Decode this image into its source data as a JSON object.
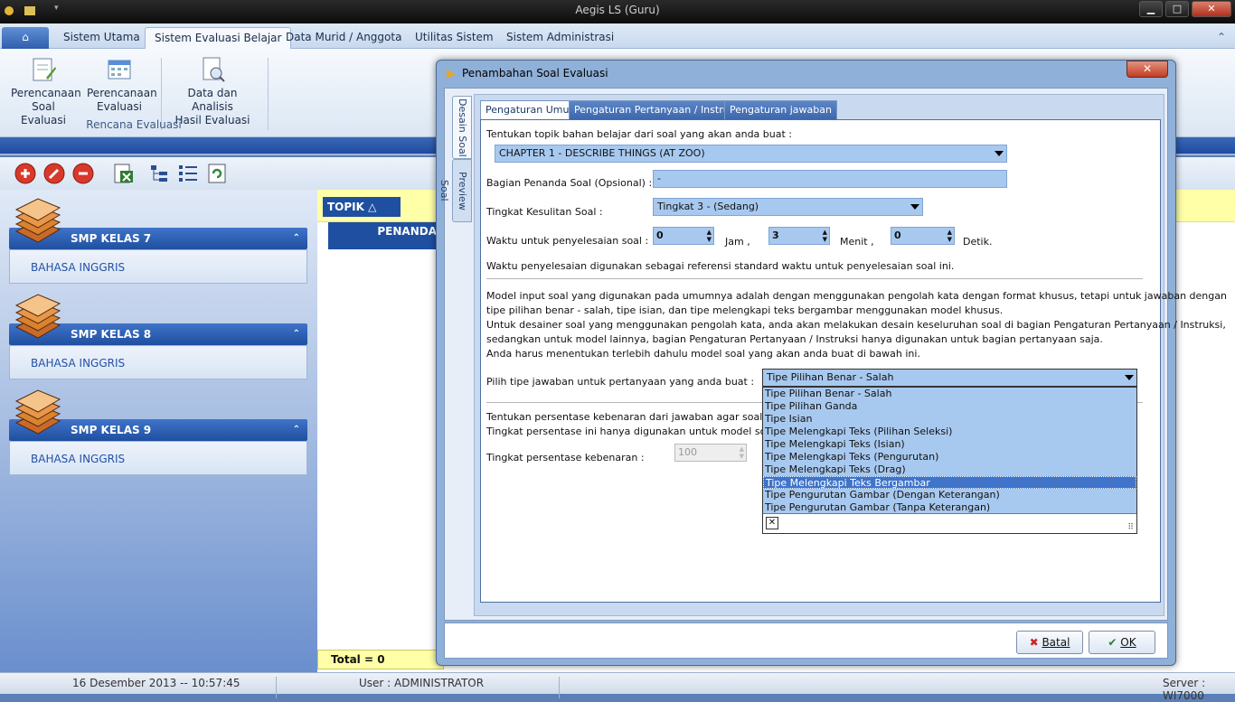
{
  "window": {
    "title": "Aegis LS (Guru)",
    "min": "▁",
    "max": "□",
    "close": "✕"
  },
  "ribbon": {
    "tabs": [
      "Sistem Utama",
      "Sistem Evaluasi Belajar",
      "Data Murid / Anggota",
      "Utilitas Sistem",
      "Sistem Administrasi"
    ],
    "active_tab": "Sistem Evaluasi Belajar",
    "buttons": [
      {
        "line1": "Perencanaan",
        "line2": "Soal Evaluasi"
      },
      {
        "line1": "Perencanaan",
        "line2": "Evaluasi"
      },
      {
        "line1": "Data dan Analisis",
        "line2": "Hasil Evaluasi"
      }
    ],
    "group_label": "Rencana Evaluasi",
    "collapse_glyph": "⌃"
  },
  "sidebar": {
    "groups": [
      {
        "title": "SMP KELAS 7",
        "item": "BAHASA INGGRIS"
      },
      {
        "title": "SMP KELAS 8",
        "item": "BAHASA INGGRIS"
      },
      {
        "title": "SMP KELAS 9",
        "item": "BAHASA INGGRIS"
      }
    ],
    "chevron": "⌃"
  },
  "grid": {
    "topik_header": "TOPIK △",
    "penanda_header": "PENANDA",
    "total": "Total = 0"
  },
  "status": {
    "datetime": "16 Desember 2013 -- 10:57:45",
    "user": "User : ADMINISTRATOR",
    "server": "Server : WI7000"
  },
  "dialog": {
    "title": "Penambahan Soal Evaluasi",
    "vtabs": [
      "Desain Soal",
      "Preview Soal"
    ],
    "tabs": [
      "Pengaturan Umum",
      "Pengaturan Pertanyaan / Instruksi",
      "Pengaturan jawaban"
    ],
    "topic_label": "Tentukan topik bahan belajar dari soal yang akan anda buat :",
    "topic_value": "CHAPTER 1 - DESCRIBE THINGS (AT ZOO)",
    "marker_label": "Bagian Penanda Soal (Opsional) :",
    "marker_value": "-",
    "difficulty_label": "Tingkat Kesulitan Soal :",
    "difficulty_value": "Tingkat 3 - (Sedang)",
    "time_label": "Waktu untuk penyelesaian soal :",
    "hours": "0",
    "hours_unit": "Jam ,",
    "minutes": "3",
    "minutes_unit": "Menit ,",
    "seconds": "0",
    "seconds_unit": "Detik.",
    "time_note": "Waktu penyelesaian digunakan sebagai referensi standard waktu untuk penyelesaian soal ini.",
    "model_text": [
      "Model input soal yang digunakan pada umumnya adalah dengan menggunakan pengolah kata dengan format khusus, tetapi untuk jawaban dengan",
      "tipe pilihan benar - salah, tipe isian, dan tipe melengkapi teks bergambar menggunakan model khusus.",
      "Untuk desainer soal yang menggunakan pengolah kata, anda akan melakukan desain keseluruhan soal di bagian Pengaturan Pertanyaan / Instruksi,",
      "sedangkan untuk model lainnya, bagian Pengaturan Pertanyaan / Instruksi hanya digunakan untuk bagian pertanyaan saja.",
      "Anda harus menentukan terlebih dahulu model soal yang akan anda buat di bawah ini."
    ],
    "answer_type_label": "Pilih tipe jawaban untuk pertanyaan yang anda buat :",
    "answer_type_value": "Tipe Pilihan Benar - Salah",
    "answer_options": [
      "Tipe Pilihan Benar - Salah",
      "Tipe Pilihan Ganda",
      "Tipe Isian",
      "Tipe Melengkapi Teks (Pilihan Seleksi)",
      "Tipe Melengkapi Teks (Isian)",
      "Tipe Melengkapi Teks (Pengurutan)",
      "Tipe Melengkapi Teks (Drag)",
      "Tipe Melengkapi Teks Bergambar",
      "Tipe Pengurutan Gambar (Dengan Keterangan)",
      "Tipe Pengurutan Gambar (Tanpa Keterangan)"
    ],
    "selected_option_index": 7,
    "percent_text1": "Tentukan persentase kebenaran dari jawaban agar soal ini dian",
    "percent_text2": "Tingkat persentase ini hanya digunakan untuk model soal melen",
    "percent_label": "Tingkat persentase kebenaran :",
    "percent_value": "100",
    "cancel_label": "Batal",
    "ok_label": "OK"
  },
  "colors": {
    "accent": "#1f4fa0",
    "input_bg": "#a8c9ef",
    "highlight_yellow": "#ffffa8"
  }
}
